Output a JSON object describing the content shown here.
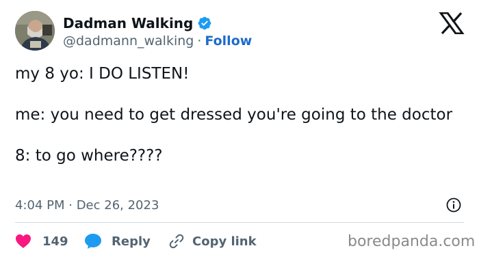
{
  "author": {
    "display_name": "Dadman Walking",
    "handle": "@dadmann_walking",
    "separator": "·",
    "follow_label": "Follow",
    "verified": true
  },
  "tweet": {
    "text": "my 8 yo: I DO LISTEN!\n\nme: you need to get dressed you're going to the doctor\n\n8: to go where????",
    "timestamp": "4:04 PM · Dec 26, 2023"
  },
  "actions": {
    "like_count": "149",
    "reply_label": "Reply",
    "copy_link_label": "Copy link"
  },
  "watermark": "boredpanda.com",
  "icons": {
    "verified": "verified-badge-icon",
    "x_logo": "x-logo-icon",
    "info": "info-icon",
    "heart": "heart-icon",
    "reply": "reply-bubble-icon",
    "link": "link-icon"
  },
  "colors": {
    "accent": "#1d9bf0",
    "follow": "#1d6cc8",
    "heart": "#f91880",
    "text": "#0f1419",
    "muted": "#536471"
  }
}
